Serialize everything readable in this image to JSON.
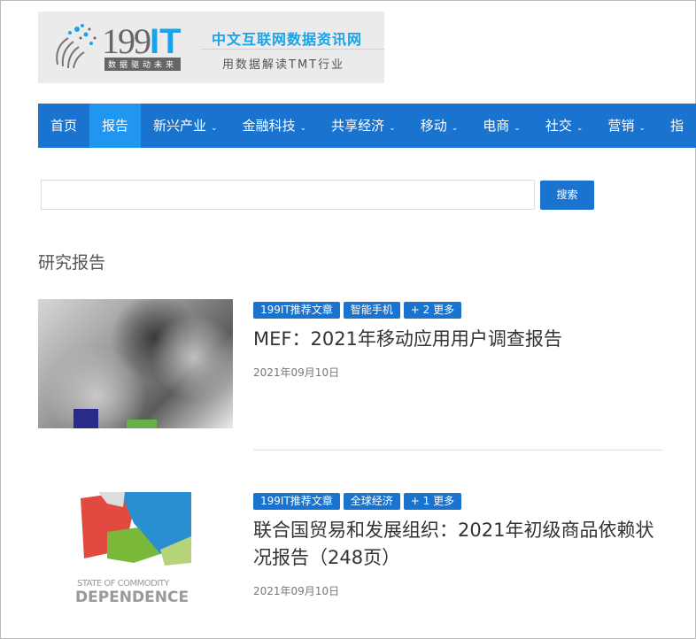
{
  "logo": {
    "number": "199",
    "it": "IT",
    "slogan": "数据驱动未来",
    "tagline_main": "中文互联网数据资讯网",
    "tagline_sub": "用数据解读TMT行业"
  },
  "nav": {
    "items": [
      {
        "label": "首页",
        "dropdown": false
      },
      {
        "label": "报告",
        "dropdown": false,
        "active": true
      },
      {
        "label": "新兴产业",
        "dropdown": true
      },
      {
        "label": "金融科技",
        "dropdown": true
      },
      {
        "label": "共享经济",
        "dropdown": true
      },
      {
        "label": "移动",
        "dropdown": true
      },
      {
        "label": "电商",
        "dropdown": true
      },
      {
        "label": "社交",
        "dropdown": true
      },
      {
        "label": "营销",
        "dropdown": true
      },
      {
        "label": "指",
        "dropdown": false
      }
    ],
    "chevron": "⌄"
  },
  "search": {
    "value": "",
    "placeholder": "",
    "button_label": "搜索"
  },
  "section_heading": "研究报告",
  "articles": [
    {
      "tags": [
        "199IT推荐文章",
        "智能手机",
        "+ 2 更多"
      ],
      "title": "MEF：2021年移动应用用户调查报告",
      "date": "2021年09月10日"
    },
    {
      "tags": [
        "199IT推荐文章",
        "全球经济",
        "+ 1 更多"
      ],
      "title": "联合国贸易和发展组织：2021年初级商品依赖状况报告（248页）",
      "date": "2021年09月10日",
      "image_text": "STATE OF COMMODITY DEPENDENCE"
    }
  ],
  "colors": {
    "accent": "#1a73cf",
    "active_nav": "#2196f0",
    "logo_blue": "#1aa3e8"
  }
}
